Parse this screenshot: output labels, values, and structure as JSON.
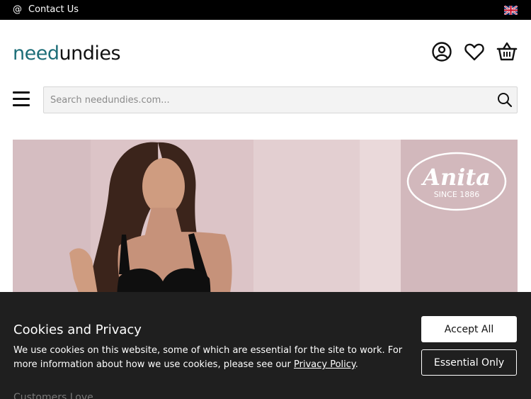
{
  "topbar": {
    "contact_icon": "at-icon",
    "contact_label": "Contact Us",
    "language_flag": "uk-flag-icon"
  },
  "header": {
    "logo_part1": "need",
    "logo_part2": "undies",
    "logo_colors": {
      "need": "#1d6e78",
      "undies": "#111111"
    },
    "icons": [
      "account-icon",
      "wishlist-heart-icon",
      "basket-icon"
    ]
  },
  "search": {
    "placeholder": "Search needundies.com..."
  },
  "hero": {
    "brand_name": "Anita",
    "brand_tagline": "SINCE 1886",
    "background_color": "#dcc5c8"
  },
  "cookie_banner": {
    "title": "Cookies and Privacy",
    "text_before_link": "We use cookies on this website, some of which are essential for the site to work. For more information about how we use cookies, please see our ",
    "link_label": "Privacy Policy",
    "text_after_link": ".",
    "accept_label": "Accept All",
    "essential_label": "Essential Only",
    "background_color": "#1f1f1f"
  },
  "below_fold": {
    "heading_peek": "Customers Love"
  }
}
